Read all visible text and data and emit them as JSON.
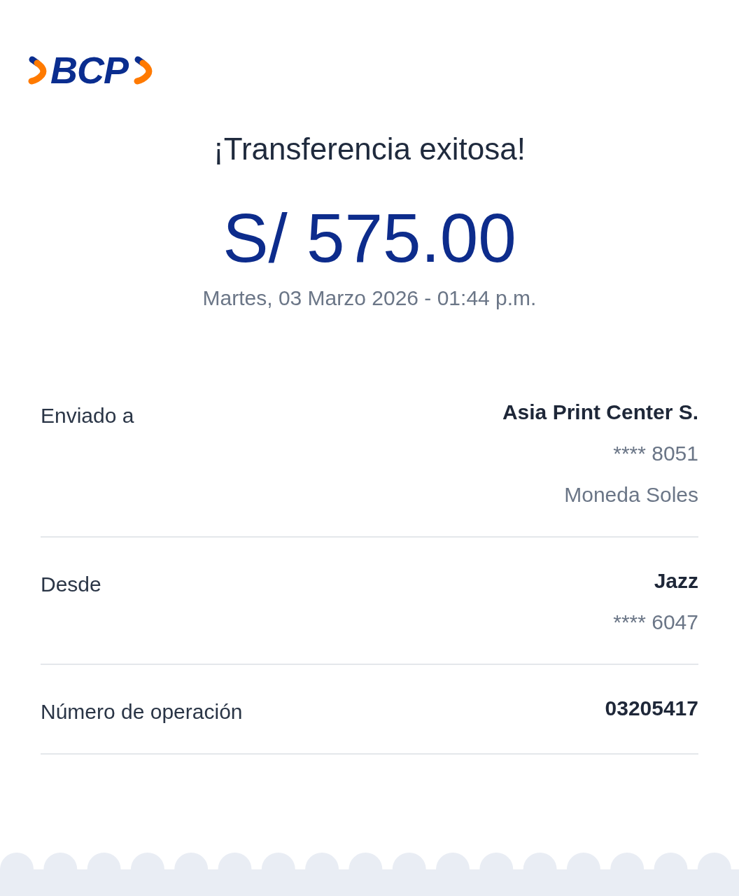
{
  "logo": {
    "text": "BCP"
  },
  "title": "¡Transferencia exitosa!",
  "amount": "S/ 575.00",
  "datetime": "Martes, 03 Marzo 2026 - 01:44 p.m.",
  "details": [
    {
      "label": "Enviado a",
      "lines": [
        {
          "text": "Asia Print Center S.",
          "kind": "primary"
        },
        {
          "text": "**** 8051",
          "kind": "secondary"
        },
        {
          "text": "Moneda Soles",
          "kind": "secondary"
        }
      ]
    },
    {
      "label": "Desde",
      "lines": [
        {
          "text": "Jazz",
          "kind": "primary"
        },
        {
          "text": "**** 6047",
          "kind": "secondary"
        }
      ]
    },
    {
      "label": "Número de operación",
      "lines": [
        {
          "text": "03205417",
          "kind": "primary"
        }
      ]
    }
  ]
}
